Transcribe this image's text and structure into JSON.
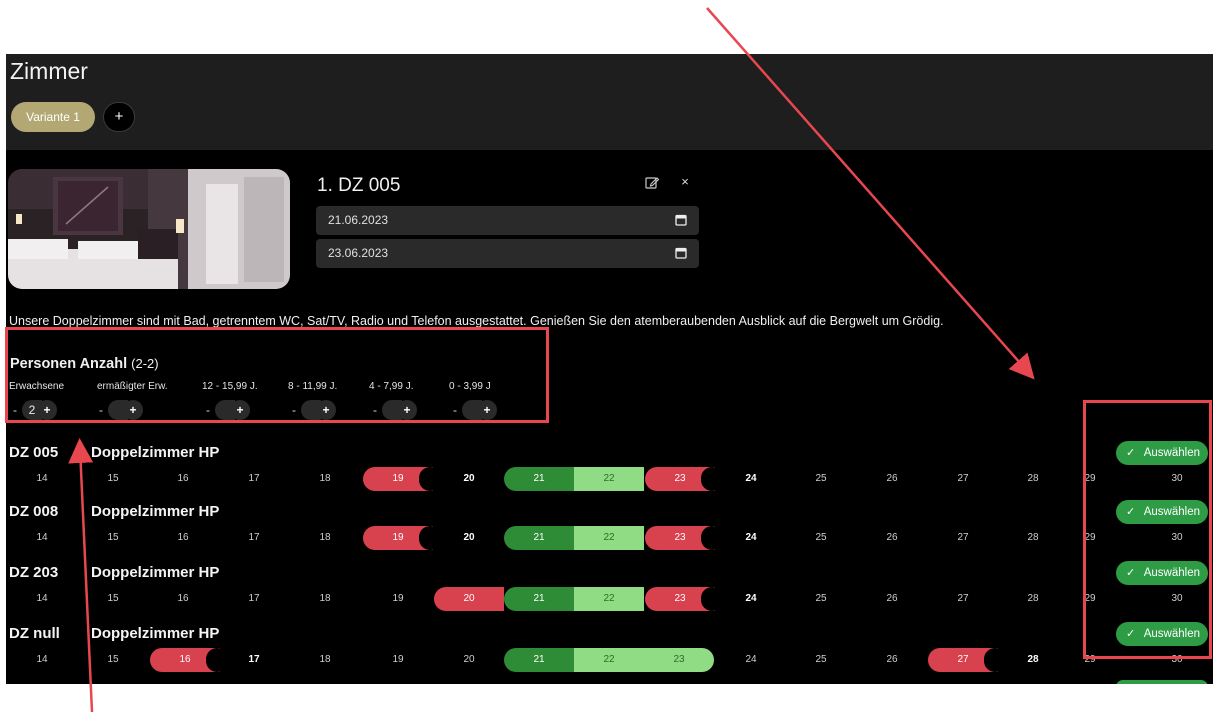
{
  "header": {
    "title": "Zimmer",
    "variant_tab": "Variante 1",
    "add_variant": "+"
  },
  "room_card": {
    "name": "1. DZ 005",
    "close_label": "×",
    "arrival_date": "21.06.2023",
    "departure_date": "23.06.2023",
    "description": "Unsere Doppelzimmer sind mit Bad, getrenntem WC, Sat/TV, Radio und Telefon ausgestattet. Genießen Sie den atemberaubenden Ausblick auf die Bergwelt um Grödig."
  },
  "persons": {
    "title": "Personen Anzahl",
    "range": "(2-2)",
    "categories": [
      {
        "label": "Erwachsene",
        "value": "2"
      },
      {
        "label": "ermäßigter Erw.",
        "value": ""
      },
      {
        "label": "12 - 15,99 J.",
        "value": ""
      },
      {
        "label": "8 - 11,99 J.",
        "value": ""
      },
      {
        "label": "4 - 7,99 J.",
        "value": ""
      },
      {
        "label": "0 - 3,99 J",
        "value": ""
      }
    ],
    "minus": "-",
    "plus": "+"
  },
  "rooms": [
    {
      "code": "DZ 005",
      "type": "Doppelzimmer HP",
      "select_label": "Auswählen",
      "last_day": "30",
      "days": [
        "14",
        "15",
        "16",
        "17",
        "18",
        "19",
        "20",
        "21",
        "22",
        "23",
        "24",
        "25",
        "26",
        "27",
        "28",
        "29"
      ]
    },
    {
      "code": "DZ 008",
      "type": "Doppelzimmer HP",
      "select_label": "Auswählen",
      "last_day": "30",
      "days": [
        "14",
        "15",
        "16",
        "17",
        "18",
        "19",
        "20",
        "21",
        "22",
        "23",
        "24",
        "25",
        "26",
        "27",
        "28",
        "29"
      ]
    },
    {
      "code": "DZ 203",
      "type": "Doppelzimmer HP",
      "select_label": "Auswählen",
      "last_day": "30",
      "days": [
        "14",
        "15",
        "16",
        "17",
        "18",
        "19",
        "20",
        "21",
        "22",
        "23",
        "24",
        "25",
        "26",
        "27",
        "28",
        "29"
      ]
    },
    {
      "code": "DZ null",
      "type": "Doppelzimmer HP",
      "select_label": "Auswählen",
      "last_day": "30",
      "days": [
        "14",
        "15",
        "16",
        "17",
        "18",
        "19",
        "20",
        "21",
        "22",
        "23",
        "24",
        "25",
        "26",
        "27",
        "28",
        "29"
      ]
    }
  ],
  "colors": {
    "booked": "#d8424f",
    "selected": "#2f8c36",
    "stay": "#8fdc84",
    "select_button": "#2e9b45",
    "variant_pill": "#b3a874",
    "annotation": "#e8474f"
  },
  "icons": {
    "edit": "edit-icon",
    "close": "close-icon",
    "calendar": "calendar-icon",
    "check": "check-icon"
  }
}
